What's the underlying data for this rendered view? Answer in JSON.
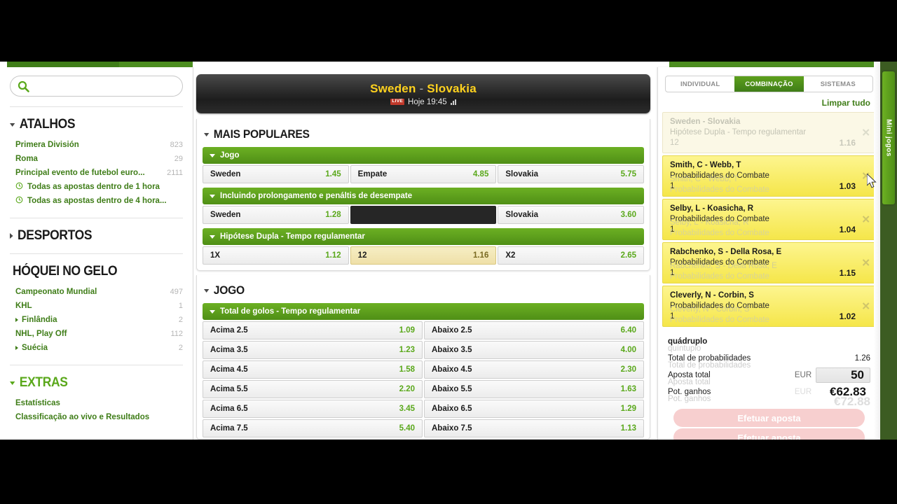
{
  "sidebar": {
    "search": {
      "placeholder": "",
      "value": "",
      "icon": "search-icon"
    },
    "shortcuts": {
      "title": "ATALHOS",
      "items": [
        {
          "label": "Primera División",
          "count": "823",
          "icon": ""
        },
        {
          "label": "Roma",
          "count": "29",
          "icon": ""
        },
        {
          "label": "Principal evento de futebol euro...",
          "count": "2111",
          "icon": ""
        },
        {
          "label": "Todas as apostas dentro de 1 hora",
          "count": "",
          "icon": "clock-icon"
        },
        {
          "label": "Todas as apostas dentro de 4 hora...",
          "count": "",
          "icon": "clock-icon"
        }
      ]
    },
    "sports": {
      "title": "DESPORTOS"
    },
    "hockey": {
      "title": "HÓQUEI NO GELO",
      "items": [
        {
          "label": "Campeonato Mundial",
          "count": "497",
          "expandable": false
        },
        {
          "label": "KHL",
          "count": "1",
          "expandable": false
        },
        {
          "label": "Finlândia",
          "count": "2",
          "expandable": true
        },
        {
          "label": "NHL, Play Off",
          "count": "112",
          "expandable": false
        },
        {
          "label": "Suécia",
          "count": "2",
          "expandable": true
        }
      ]
    },
    "extras": {
      "title": "EXTRAS",
      "items": [
        {
          "label": "Estatísticas"
        },
        {
          "label": "Classificação ao vivo e Resultados"
        }
      ]
    }
  },
  "center": {
    "match": {
      "home": "Sweden",
      "separator": "-",
      "away": "Slovakia",
      "live_badge": "LIVE",
      "time": "Hoje 19:45"
    },
    "groups": [
      {
        "title": "MAIS POPULARES",
        "markets": [
          {
            "name": "Jogo",
            "rows": [
              [
                {
                  "label": "Sweden",
                  "odd": "1.45",
                  "state": "normal"
                },
                {
                  "label": "Empate",
                  "odd": "4.85",
                  "state": "normal"
                },
                {
                  "label": "Slovakia",
                  "odd": "5.75",
                  "state": "normal"
                }
              ]
            ]
          },
          {
            "name": "Incluindo prolongamento e penáltis de desempate",
            "rows": [
              [
                {
                  "label": "Sweden",
                  "odd": "1.28",
                  "state": "normal"
                },
                {
                  "label": "",
                  "odd": "",
                  "state": "empty"
                },
                {
                  "label": "Slovakia",
                  "odd": "3.60",
                  "state": "normal"
                }
              ]
            ]
          },
          {
            "name": "Hipótese Dupla - Tempo regulamentar",
            "rows": [
              [
                {
                  "label": "1X",
                  "odd": "1.12",
                  "state": "normal"
                },
                {
                  "label": "12",
                  "odd": "1.16",
                  "state": "selected"
                },
                {
                  "label": "X2",
                  "odd": "2.65",
                  "state": "normal"
                }
              ]
            ]
          }
        ]
      },
      {
        "title": "JOGO",
        "markets": [
          {
            "name": "Total de golos - Tempo regulamentar",
            "rows": [
              [
                {
                  "label": "Acima 2.5",
                  "odd": "1.09",
                  "state": "normal"
                },
                {
                  "label": "Abaixo 2.5",
                  "odd": "6.40",
                  "state": "normal"
                }
              ],
              [
                {
                  "label": "Acima 3.5",
                  "odd": "1.23",
                  "state": "normal"
                },
                {
                  "label": "Abaixo 3.5",
                  "odd": "4.00",
                  "state": "normal"
                }
              ],
              [
                {
                  "label": "Acima 4.5",
                  "odd": "1.58",
                  "state": "normal"
                },
                {
                  "label": "Abaixo 4.5",
                  "odd": "2.30",
                  "state": "normal"
                }
              ],
              [
                {
                  "label": "Acima 5.5",
                  "odd": "2.20",
                  "state": "normal"
                },
                {
                  "label": "Abaixo 5.5",
                  "odd": "1.63",
                  "state": "normal"
                }
              ],
              [
                {
                  "label": "Acima 6.5",
                  "odd": "3.45",
                  "state": "normal"
                },
                {
                  "label": "Abaixo 6.5",
                  "odd": "1.29",
                  "state": "normal"
                }
              ],
              [
                {
                  "label": "Acima 7.5",
                  "odd": "5.40",
                  "state": "normal"
                },
                {
                  "label": "Abaixo 7.5",
                  "odd": "1.13",
                  "state": "normal"
                }
              ]
            ]
          }
        ]
      }
    ]
  },
  "betslip": {
    "tabs": [
      {
        "label": "INDIVIDUAL",
        "active": false
      },
      {
        "label": "COMBINAÇÃO",
        "active": true
      },
      {
        "label": "SISTEMAS",
        "active": false
      }
    ],
    "clear_all": "Limpar tudo",
    "items": [
      {
        "event": "Sweden  -  Slovakia",
        "market": "Hipótese Dupla - Tempo regulamentar",
        "pick": "12",
        "odd": "1.16",
        "state": "faded",
        "remove": "✕"
      },
      {
        "event": "Smith, C  -  Webb, T",
        "market": "Probabilidades do Combate",
        "pick": "1",
        "odd": "1.03",
        "state": "hot",
        "remove": "✕"
      },
      {
        "event": "Selby, L  -  Koasicha, R",
        "market": "Probabilidades do Combate",
        "pick": "1",
        "odd": "1.04",
        "state": "hot",
        "remove": "✕"
      },
      {
        "event": "Rabchenko, S  -  Della Rosa, E",
        "market": "Probabilidades do Combate",
        "pick": "1",
        "odd": "1.15",
        "state": "hot",
        "remove": "✕"
      },
      {
        "event": "Cleverly, N  -  Corbin, S",
        "market": "Probabilidades do Combate",
        "pick": "1",
        "odd": "1.02",
        "state": "hot",
        "remove": "✕"
      }
    ],
    "summary": {
      "combo_type": "quádruplo",
      "combo_type_ghost": "quíntuplo",
      "total_odds_label": "Total de probabilidades",
      "total_odds": "1.26",
      "stake_label": "Aposta total",
      "currency": "EUR",
      "stake": "50",
      "winnings_label": "Pot. ganhos",
      "winnings": "€62.83",
      "winnings_ghost": "€72.88",
      "place_bet": "Efetuar aposta"
    }
  },
  "rail": {
    "mini_games": "Mini jogos"
  }
}
